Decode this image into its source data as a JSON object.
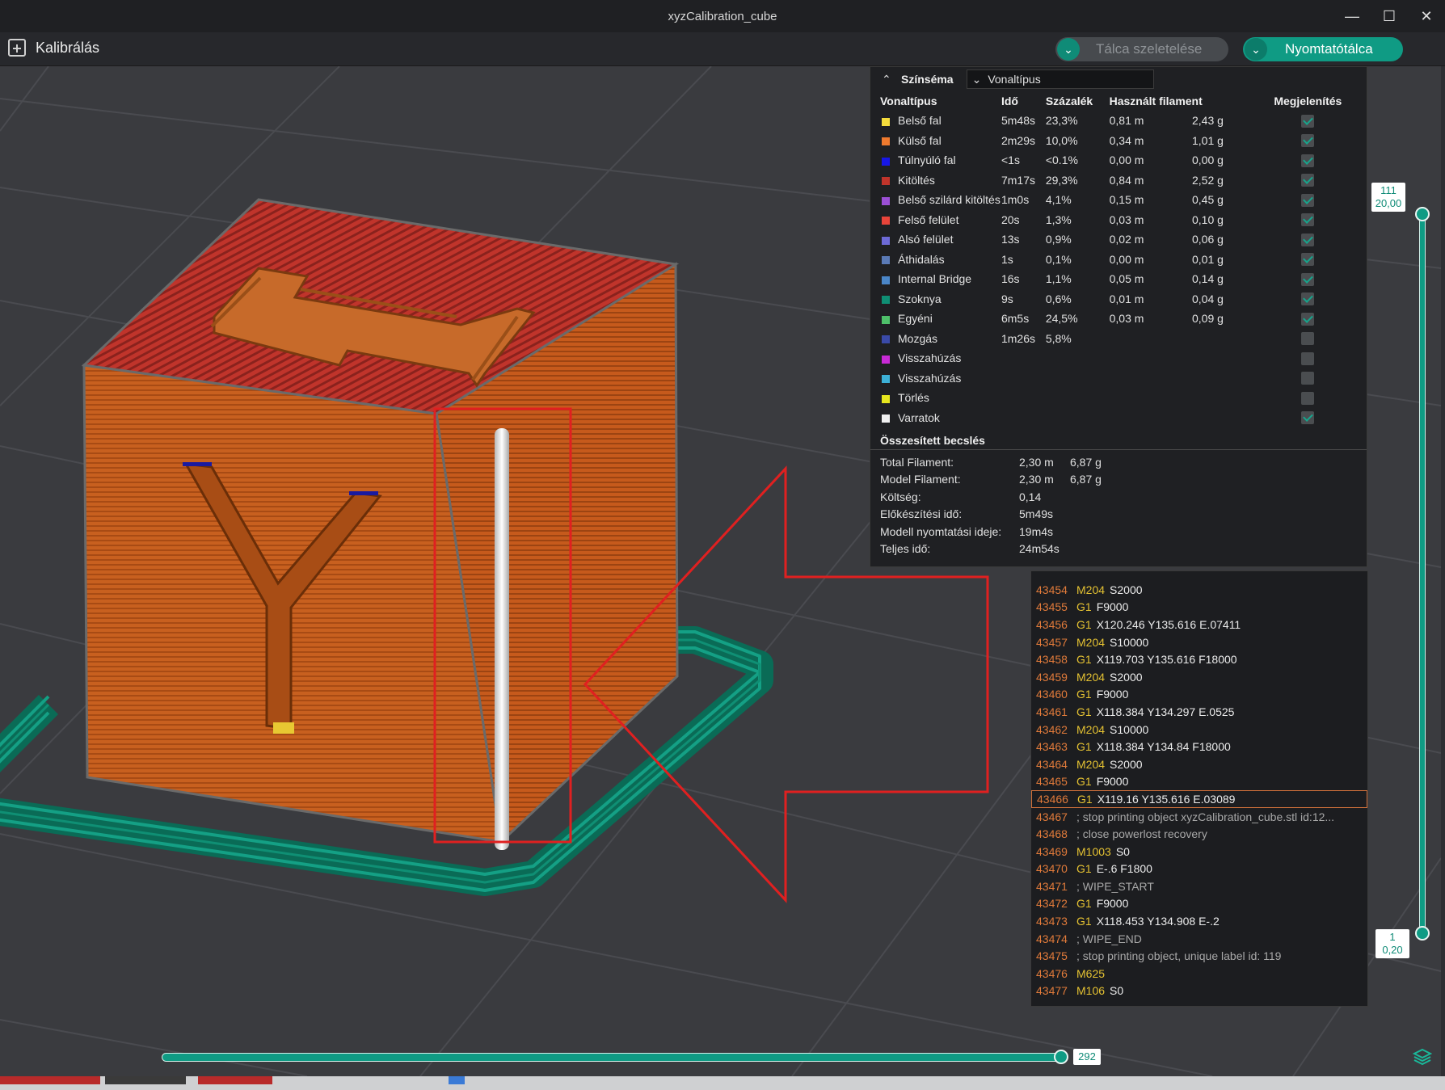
{
  "window": {
    "title": "xyzCalibration_cube",
    "controls": [
      "minimize-icon",
      "maximize-icon",
      "close-icon"
    ]
  },
  "toolbar": {
    "calibrate_label": "Kalibrálás",
    "slice_label": "Tálca szeletelése",
    "print_label": "Nyomtatótálca"
  },
  "legend": {
    "title": "Színséma",
    "view_type": "Vonaltípus",
    "headers": [
      "Vonaltípus",
      "Idő",
      "Százalék",
      "Használt filament",
      "",
      "Megjelenítés"
    ],
    "rows": [
      {
        "color": "#f4dc3c",
        "name": "Belső fal",
        "time": "5m48s",
        "pct": "23,3%",
        "len": "0,81 m",
        "weight": "2,43 g",
        "shown": true
      },
      {
        "color": "#ef7a2e",
        "name": "Külső fal",
        "time": "2m29s",
        "pct": "10,0%",
        "len": "0,34 m",
        "weight": "1,01 g",
        "shown": true
      },
      {
        "color": "#1717e6",
        "name": "Túlnyúló fal",
        "time": "<1s",
        "pct": "<0.1%",
        "len": "0,00 m",
        "weight": "0,00 g",
        "shown": true
      },
      {
        "color": "#c0342b",
        "name": "Kitöltés",
        "time": "7m17s",
        "pct": "29,3%",
        "len": "0,84 m",
        "weight": "2,52 g",
        "shown": true
      },
      {
        "color": "#9b4fd6",
        "name": "Belső szilárd kitöltés",
        "time": "1m0s",
        "pct": "4,1%",
        "len": "0,15 m",
        "weight": "0,45 g",
        "shown": true
      },
      {
        "color": "#e8443a",
        "name": "Felső felület",
        "time": "20s",
        "pct": "1,3%",
        "len": "0,03 m",
        "weight": "0,10 g",
        "shown": true
      },
      {
        "color": "#6d6ad6",
        "name": "Alsó felület",
        "time": "13s",
        "pct": "0,9%",
        "len": "0,02 m",
        "weight": "0,06 g",
        "shown": true
      },
      {
        "color": "#5a7ab6",
        "name": "Áthidalás",
        "time": "1s",
        "pct": "0,1%",
        "len": "0,00 m",
        "weight": "0,01 g",
        "shown": true
      },
      {
        "color": "#4a86c8",
        "name": "Internal Bridge",
        "time": "16s",
        "pct": "1,1%",
        "len": "0,05 m",
        "weight": "0,14 g",
        "shown": true
      },
      {
        "color": "#0f8f74",
        "name": "Szoknya",
        "time": "9s",
        "pct": "0,6%",
        "len": "0,01 m",
        "weight": "0,04 g",
        "shown": true
      },
      {
        "color": "#4ec06a",
        "name": "Egyéni",
        "time": "6m5s",
        "pct": "24,5%",
        "len": "0,03 m",
        "weight": "0,09 g",
        "shown": true
      },
      {
        "color": "#3a4aa8",
        "name": "Mozgás",
        "time": "1m26s",
        "pct": "5,8%",
        "len": "",
        "weight": "",
        "shown": false
      },
      {
        "color": "#c82ad6",
        "name": "Visszahúzás",
        "time": "",
        "pct": "",
        "len": "",
        "weight": "",
        "shown": false
      },
      {
        "color": "#3cb0d6",
        "name": "Visszahúzás",
        "time": "",
        "pct": "",
        "len": "",
        "weight": "",
        "shown": false
      },
      {
        "color": "#e6e61e",
        "name": "Törlés",
        "time": "",
        "pct": "",
        "len": "",
        "weight": "",
        "shown": false
      },
      {
        "color": "#f0f0f0",
        "name": "Varratok",
        "time": "",
        "pct": "",
        "len": "",
        "weight": "",
        "shown": true
      }
    ],
    "summary_title": "Összesített becslés",
    "summary": [
      {
        "k": "Total Filament:",
        "v1": "2,30 m",
        "v2": "6,87 g"
      },
      {
        "k": "Model Filament:",
        "v1": "2,30 m",
        "v2": "6,87 g"
      },
      {
        "k": "Költség:",
        "v1": "0,14",
        "v2": ""
      },
      {
        "k": "Előkészítési idő:",
        "v1": "5m49s",
        "v2": ""
      },
      {
        "k": "Modell nyomtatási ideje:",
        "v1": "19m4s",
        "v2": ""
      },
      {
        "k": "Teljes idő:",
        "v1": "24m54s",
        "v2": ""
      }
    ]
  },
  "gcode": {
    "lines": [
      {
        "n": "43454",
        "cmd": "M204",
        "args": "S2000",
        "comment": ""
      },
      {
        "n": "43455",
        "cmd": "G1",
        "args": "F9000",
        "comment": ""
      },
      {
        "n": "43456",
        "cmd": "G1",
        "args": "X120.246 Y135.616 E.07411",
        "comment": ""
      },
      {
        "n": "43457",
        "cmd": "M204",
        "args": "S10000",
        "comment": ""
      },
      {
        "n": "43458",
        "cmd": "G1",
        "args": "X119.703 Y135.616 F18000",
        "comment": ""
      },
      {
        "n": "43459",
        "cmd": "M204",
        "args": "S2000",
        "comment": ""
      },
      {
        "n": "43460",
        "cmd": "G1",
        "args": "F9000",
        "comment": ""
      },
      {
        "n": "43461",
        "cmd": "G1",
        "args": "X118.384 Y134.297 E.0525",
        "comment": ""
      },
      {
        "n": "43462",
        "cmd": "M204",
        "args": "S10000",
        "comment": ""
      },
      {
        "n": "43463",
        "cmd": "G1",
        "args": "X118.384 Y134.84 F18000",
        "comment": ""
      },
      {
        "n": "43464",
        "cmd": "M204",
        "args": "S2000",
        "comment": ""
      },
      {
        "n": "43465",
        "cmd": "G1",
        "args": "F9000",
        "comment": ""
      },
      {
        "n": "43466",
        "cmd": "G1",
        "args": "X119.16 Y135.616 E.03089",
        "comment": "",
        "selected": true
      },
      {
        "n": "43467",
        "cmd": "",
        "args": "",
        "comment": "; stop printing object xyzCalibration_cube.stl id:12..."
      },
      {
        "n": "43468",
        "cmd": "",
        "args": "",
        "comment": "; close powerlost recovery"
      },
      {
        "n": "43469",
        "cmd": "M1003",
        "args": "S0",
        "comment": ""
      },
      {
        "n": "43470",
        "cmd": "G1",
        "args": "E-.6 F1800",
        "comment": ""
      },
      {
        "n": "43471",
        "cmd": "",
        "args": "",
        "comment": "; WIPE_START"
      },
      {
        "n": "43472",
        "cmd": "G1",
        "args": "F9000",
        "comment": ""
      },
      {
        "n": "43473",
        "cmd": "G1",
        "args": "X118.453 Y134.908 E-.2",
        "comment": ""
      },
      {
        "n": "43474",
        "cmd": "",
        "args": "",
        "comment": "; WIPE_END"
      },
      {
        "n": "43475",
        "cmd": "",
        "args": "",
        "comment": "; stop printing object, unique label id: 119"
      },
      {
        "n": "43476",
        "cmd": "M625",
        "args": "",
        "comment": ""
      },
      {
        "n": "43477",
        "cmd": "M106",
        "args": "S0",
        "comment": ""
      }
    ]
  },
  "layer_slider": {
    "top_layer": "111",
    "top_height": "20,00",
    "bottom_layer": "1",
    "bottom_height": "0,20"
  },
  "move_slider": {
    "value": "292"
  }
}
